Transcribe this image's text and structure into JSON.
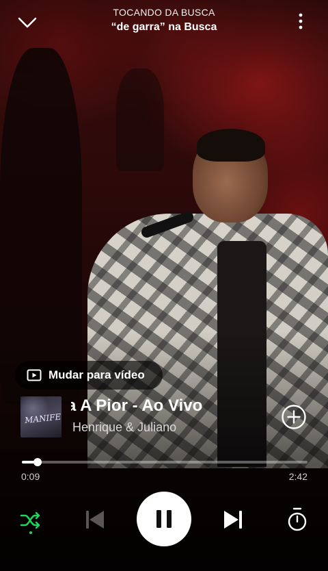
{
  "header": {
    "context_label": "TOCANDO DA BUSCA",
    "context_title": "“de garra” na Busca"
  },
  "video_switch": {
    "label": "Mudar para vídeo"
  },
  "track": {
    "title": "a A Pior - Ao Vivo",
    "artist": "Henrique & Juliano",
    "cover_text": "MANIFESTO"
  },
  "progress": {
    "elapsed": "0:09",
    "total": "2:42",
    "fraction": 0.056
  },
  "controls": {
    "shuffle_active": true,
    "is_playing": true
  },
  "colors": {
    "accent": "#1ed760",
    "background": "#2a0909"
  }
}
